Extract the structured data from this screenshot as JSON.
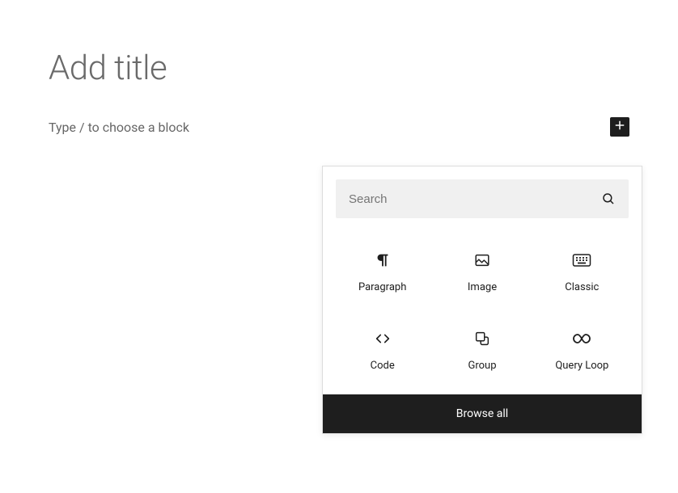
{
  "editor": {
    "title_placeholder": "Add title",
    "block_prompt": "Type / to choose a block"
  },
  "inserter": {
    "search_placeholder": "Search",
    "blocks": [
      {
        "name": "Paragraph"
      },
      {
        "name": "Image"
      },
      {
        "name": "Classic"
      },
      {
        "name": "Code"
      },
      {
        "name": "Group"
      },
      {
        "name": "Query Loop"
      }
    ],
    "browse_all_label": "Browse all"
  }
}
